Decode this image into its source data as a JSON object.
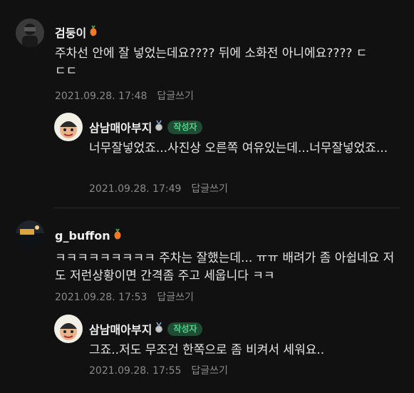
{
  "comments": [
    {
      "username": "검둥이",
      "text": "주차선 안에 잘 넣었는데요???? 뒤에 소화전 아니에요???? ㄷㄷㄷ",
      "timestamp": "2021.09.28. 17:48",
      "reply_label": "답글쓰기",
      "badge_icon": "carrot-badge-icon"
    },
    {
      "username": "삼남매아부지",
      "author_tag": "작성자",
      "text": "너무잘넣었죠...사진상 오른쪽 여유있는데...너무잘넣었죠...",
      "timestamp": "2021.09.28. 17:49",
      "reply_label": "답글쓰기",
      "badge_icon": "medal-badge-icon"
    },
    {
      "username": "g_buffon",
      "text": "ㅋㅋㅋㅋㅋㅋㅋㅋㅋ 주차는 잘했는데... ㅠㅠ 배려가 좀 아쉽네요 저도 저런상황이면 간격좀 주고 세웁니다 ㅋㅋ",
      "timestamp": "2021.09.28. 17:53",
      "reply_label": "답글쓰기",
      "badge_icon": "carrot-badge-icon"
    },
    {
      "username": "삼남매아부지",
      "author_tag": "작성자",
      "text": "그죠..저도 무조건 한쪽으로 좀 비켜서 세워요..",
      "timestamp": "2021.09.28. 17:55",
      "reply_label": "답글쓰기",
      "badge_icon": "medal-badge-icon"
    }
  ],
  "colors": {
    "background": "#111111",
    "author_tag_bg": "#1f4d33",
    "author_tag_text": "#4fd18b",
    "meta_text": "#8a8a8a"
  }
}
